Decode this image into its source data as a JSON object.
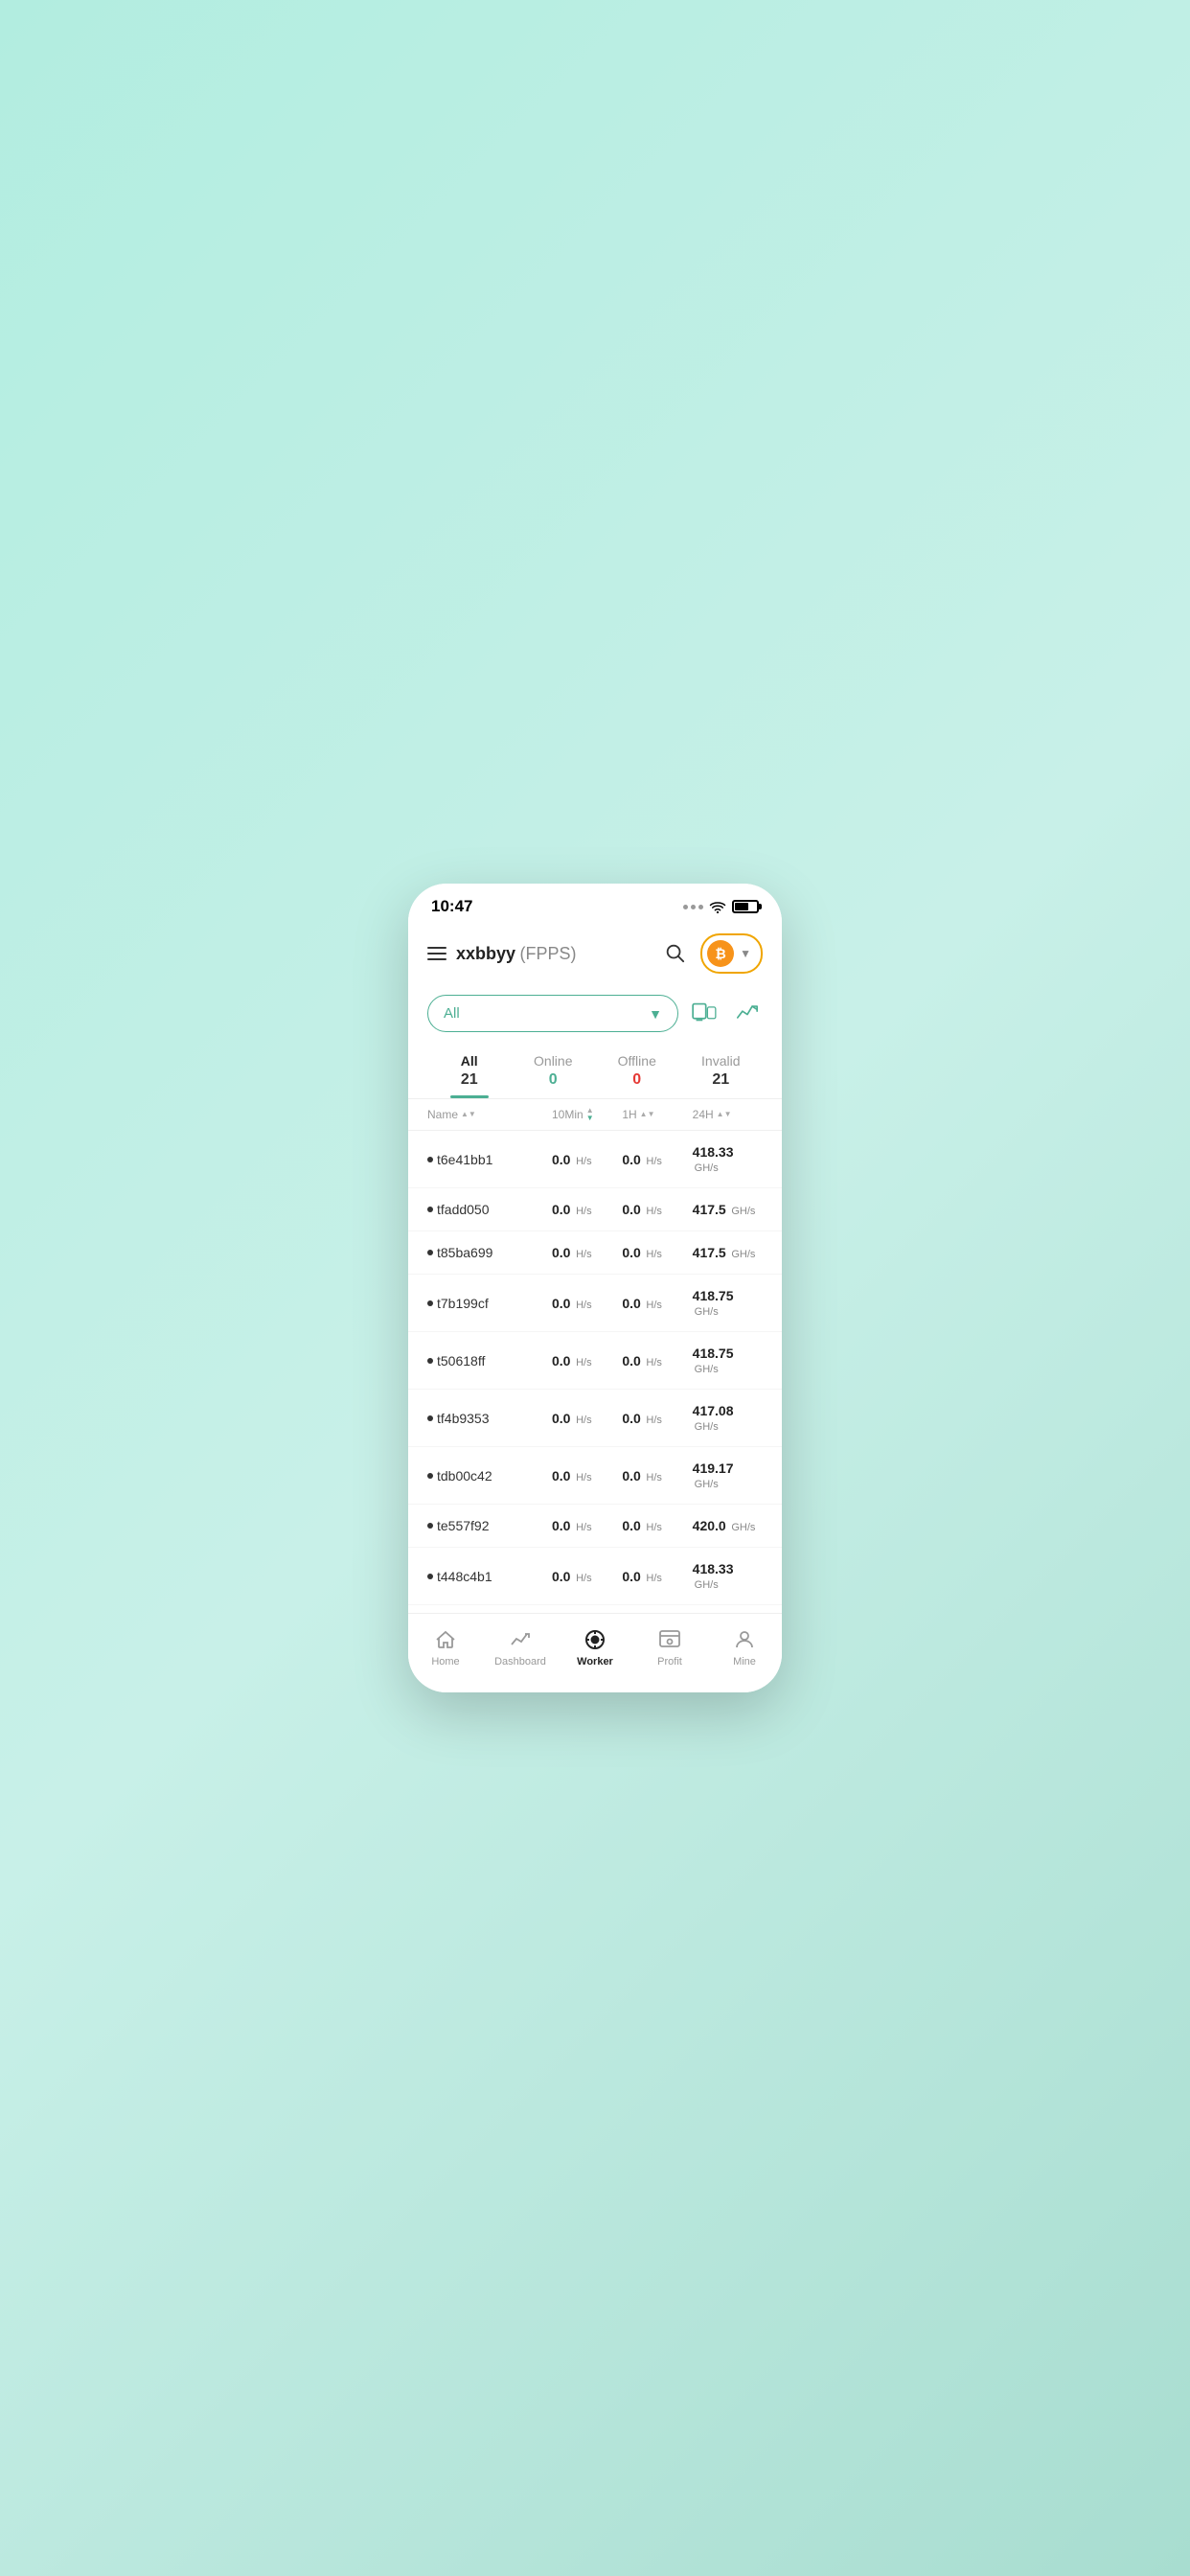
{
  "statusBar": {
    "time": "10:47"
  },
  "header": {
    "title": "xxbbyy",
    "subtitle": "(FPPS)",
    "menuLabel": "Menu"
  },
  "filter": {
    "dropdownLabel": "All",
    "dropdownIcon": "chevron-down"
  },
  "tabs": [
    {
      "name": "All",
      "count": "21",
      "active": true,
      "countColor": "dark"
    },
    {
      "name": "Online",
      "count": "0",
      "active": false,
      "countColor": "green"
    },
    {
      "name": "Offline",
      "count": "0",
      "active": false,
      "countColor": "red"
    },
    {
      "name": "Invalid",
      "count": "21",
      "active": false,
      "countColor": "dark"
    }
  ],
  "columns": {
    "name": "Name",
    "tenMin": "10Min",
    "oneH": "1H",
    "twentyFourH": "24H"
  },
  "workers": [
    {
      "name": "t6e41bb1",
      "tenMin": "0.0",
      "tenMinUnit": "H/s",
      "oneH": "0.0",
      "oneHUnit": "H/s",
      "twentyFourH": "418.33",
      "twentyFourHUnit": "GH/s"
    },
    {
      "name": "tfadd050",
      "tenMin": "0.0",
      "tenMinUnit": "H/s",
      "oneH": "0.0",
      "oneHUnit": "H/s",
      "twentyFourH": "417.5",
      "twentyFourHUnit": "GH/s"
    },
    {
      "name": "t85ba699",
      "tenMin": "0.0",
      "tenMinUnit": "H/s",
      "oneH": "0.0",
      "oneHUnit": "H/s",
      "twentyFourH": "417.5",
      "twentyFourHUnit": "GH/s"
    },
    {
      "name": "t7b199cf",
      "tenMin": "0.0",
      "tenMinUnit": "H/s",
      "oneH": "0.0",
      "oneHUnit": "H/s",
      "twentyFourH": "418.75",
      "twentyFourHUnit": "GH/s"
    },
    {
      "name": "t50618ff",
      "tenMin": "0.0",
      "tenMinUnit": "H/s",
      "oneH": "0.0",
      "oneHUnit": "H/s",
      "twentyFourH": "418.75",
      "twentyFourHUnit": "GH/s"
    },
    {
      "name": "tf4b9353",
      "tenMin": "0.0",
      "tenMinUnit": "H/s",
      "oneH": "0.0",
      "oneHUnit": "H/s",
      "twentyFourH": "417.08",
      "twentyFourHUnit": "GH/s"
    },
    {
      "name": "tdb00c42",
      "tenMin": "0.0",
      "tenMinUnit": "H/s",
      "oneH": "0.0",
      "oneHUnit": "H/s",
      "twentyFourH": "419.17",
      "twentyFourHUnit": "GH/s"
    },
    {
      "name": "te557f92",
      "tenMin": "0.0",
      "tenMinUnit": "H/s",
      "oneH": "0.0",
      "oneHUnit": "H/s",
      "twentyFourH": "420.0",
      "twentyFourHUnit": "GH/s"
    },
    {
      "name": "t448c4b1",
      "tenMin": "0.0",
      "tenMinUnit": "H/s",
      "oneH": "0.0",
      "oneHUnit": "H/s",
      "twentyFourH": "418.33",
      "twentyFourHUnit": "GH/s"
    }
  ],
  "nav": [
    {
      "id": "home",
      "label": "Home",
      "active": false
    },
    {
      "id": "dashboard",
      "label": "Dashboard",
      "active": false
    },
    {
      "id": "worker",
      "label": "Worker",
      "active": true
    },
    {
      "id": "profit",
      "label": "Profit",
      "active": false
    },
    {
      "id": "mine",
      "label": "Mine",
      "active": false
    }
  ],
  "colors": {
    "accent": "#4caf93",
    "bitcoin": "#f7931a",
    "activeTab": "#4caf93"
  }
}
